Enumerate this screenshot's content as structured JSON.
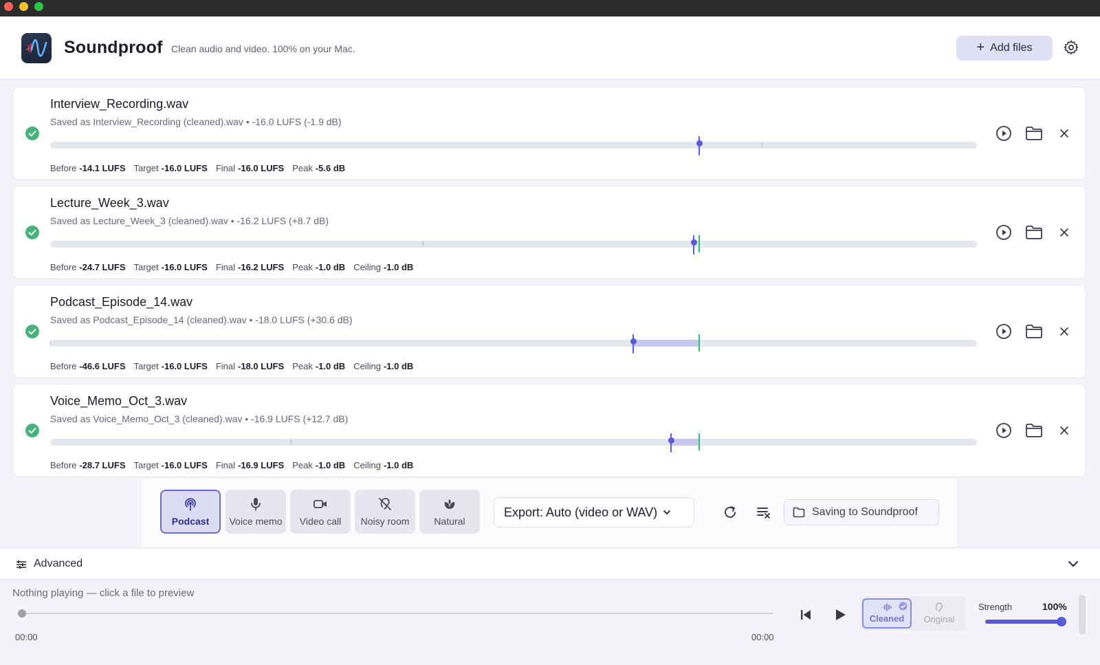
{
  "app": {
    "title": "Soundproof",
    "tagline": "Clean audio and video. 100% on your Mac.",
    "add_files_label": "Add files",
    "accent_color": "#5b5bd6",
    "success_color": "#45b37a"
  },
  "files": [
    {
      "name": "Interview_Recording.wav",
      "saved": "Saved as Interview_Recording (cleaned).wav • -16.0 LUFS (-1.9 dB)",
      "stats": [
        {
          "label": "Before",
          "value": "-14.1 LUFS"
        },
        {
          "label": "Target",
          "value": "-16.0 LUFS"
        },
        {
          "label": "Final",
          "value": "-16.0 LUFS"
        },
        {
          "label": "Peak",
          "value": "-5.6 dB"
        }
      ]
    },
    {
      "name": "Lecture_Week_3.wav",
      "saved": "Saved as Lecture_Week_3 (cleaned).wav • -16.2 LUFS (+8.7 dB)",
      "stats": [
        {
          "label": "Before",
          "value": "-24.7 LUFS"
        },
        {
          "label": "Target",
          "value": "-16.0 LUFS"
        },
        {
          "label": "Final",
          "value": "-16.2 LUFS"
        },
        {
          "label": "Peak",
          "value": "-1.0 dB"
        },
        {
          "label": "Ceiling",
          "value": "-1.0 dB"
        }
      ]
    },
    {
      "name": "Podcast_Episode_14.wav",
      "saved": "Saved as Podcast_Episode_14 (cleaned).wav • -18.0 LUFS (+30.6 dB)",
      "stats": [
        {
          "label": "Before",
          "value": "-46.6 LUFS"
        },
        {
          "label": "Target",
          "value": "-16.0 LUFS"
        },
        {
          "label": "Final",
          "value": "-18.0 LUFS"
        },
        {
          "label": "Peak",
          "value": "-1.0 dB"
        },
        {
          "label": "Ceiling",
          "value": "-1.0 dB"
        }
      ]
    },
    {
      "name": "Voice_Memo_Oct_3.wav",
      "saved": "Saved as Voice_Memo_Oct_3 (cleaned).wav • -16.9 LUFS (+12.7 dB)",
      "stats": [
        {
          "label": "Before",
          "value": "-28.7 LUFS"
        },
        {
          "label": "Target",
          "value": "-16.0 LUFS"
        },
        {
          "label": "Final",
          "value": "-16.9 LUFS"
        },
        {
          "label": "Peak",
          "value": "-1.0 dB"
        },
        {
          "label": "Ceiling",
          "value": "-1.0 dB"
        }
      ]
    }
  ],
  "presets": [
    {
      "label": "Podcast",
      "icon": "podcast-icon",
      "active": true
    },
    {
      "label": "Voice memo",
      "icon": "microphone-icon",
      "active": false
    },
    {
      "label": "Video call",
      "icon": "video-camera-icon",
      "active": false
    },
    {
      "label": "Noisy room",
      "icon": "ear-off-icon",
      "active": false
    },
    {
      "label": "Natural",
      "icon": "leaf-icon",
      "active": false
    }
  ],
  "export_label": "Export: Auto (video or WAV)",
  "saving_label": "Saving to Soundproof",
  "advanced_label": "Advanced",
  "player": {
    "now_playing": "Nothing playing — click a file to preview",
    "time_start": "00:00",
    "time_end": "00:00",
    "cleaned_label": "Cleaned",
    "original_label": "Original",
    "strength_label": "Strength",
    "strength_value": "100%",
    "strength_level": 1.0
  }
}
